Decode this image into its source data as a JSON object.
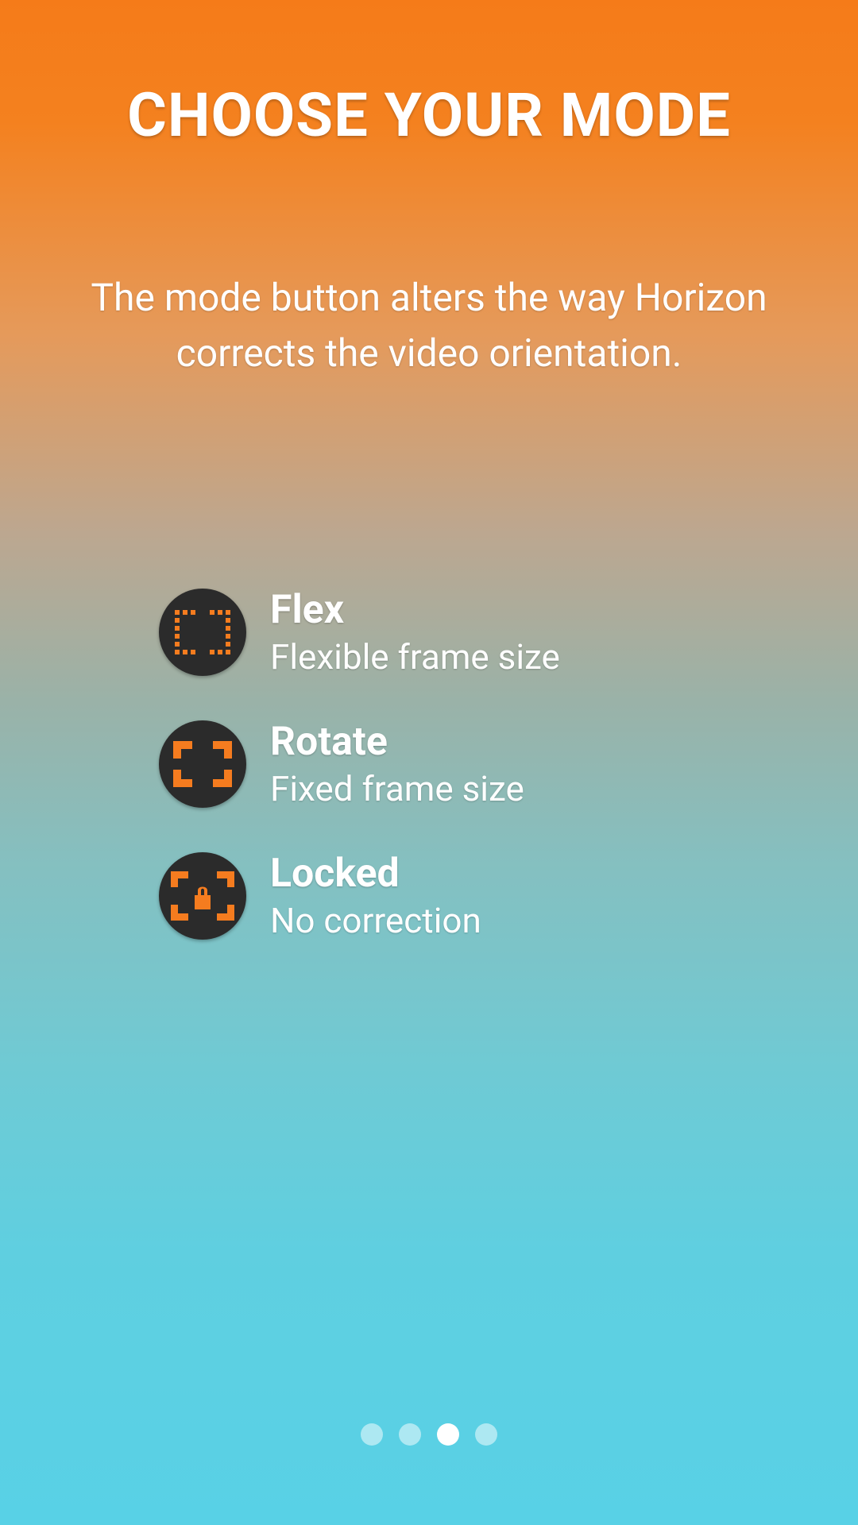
{
  "header": {
    "title": "CHOOSE YOUR MODE",
    "description": "The mode button alters the way Horizon corrects the video orientation."
  },
  "modes": [
    {
      "title": "Flex",
      "subtitle": "Flexible frame size",
      "icon": "flex-bracket-icon"
    },
    {
      "title": "Rotate",
      "subtitle": "Fixed frame size",
      "icon": "rotate-bracket-icon"
    },
    {
      "title": "Locked",
      "subtitle": "No correction",
      "icon": "locked-bracket-icon"
    }
  ],
  "pager": {
    "count": 4,
    "active_index": 2
  },
  "colors": {
    "accent": "#f57c1f",
    "icon_bg": "#2b2b2b",
    "text": "#ffffff"
  }
}
